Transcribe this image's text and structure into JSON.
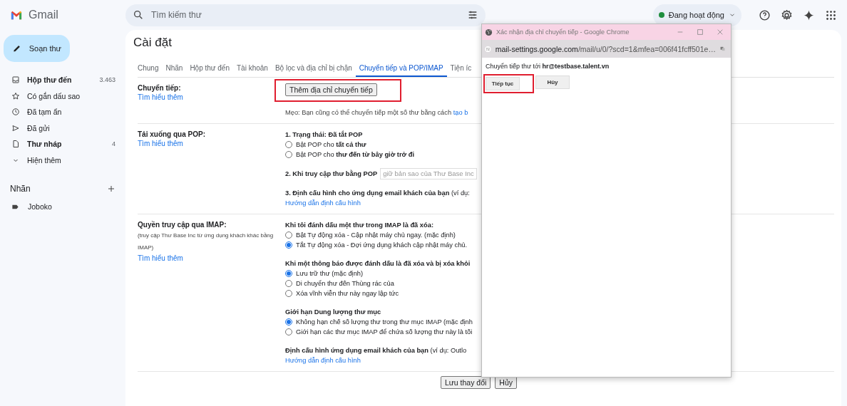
{
  "topbar": {
    "logo": "Gmail",
    "search": {
      "placeholder": "Tìm kiếm thư"
    },
    "status": {
      "label": "Đang hoạt động",
      "color": "#1e8e3e"
    }
  },
  "sidebar": {
    "compose": "Soạn thư",
    "items": [
      {
        "kind": "inbox",
        "label": "Hộp thư đến",
        "count": "3.463",
        "bold": true
      },
      {
        "kind": "star",
        "label": "Có gắn dấu sao",
        "bold": false
      },
      {
        "kind": "snooze",
        "label": "Đã tạm ẩn",
        "bold": false
      },
      {
        "kind": "sent",
        "label": "Đã gửi",
        "bold": false
      },
      {
        "kind": "draft",
        "label": "Thư nháp",
        "count": "4",
        "bold": true
      },
      {
        "kind": "more",
        "label": "Hiện thêm",
        "bold": false
      }
    ],
    "labels_heading": "Nhãn",
    "labels": [
      {
        "name": "Joboko"
      }
    ]
  },
  "settings": {
    "title": "Cài đặt",
    "tabs": [
      {
        "label": "Chung",
        "selected": false
      },
      {
        "label": "Nhãn",
        "selected": false
      },
      {
        "label": "Hộp thư đến",
        "selected": false
      },
      {
        "label": "Tài khoản",
        "selected": false
      },
      {
        "label": "Bộ lọc và địa chỉ bị chặn",
        "selected": false
      },
      {
        "label": "Chuyển tiếp và POP/IMAP",
        "selected": true
      },
      {
        "label": "Tiện íc",
        "selected": false
      }
    ],
    "sections": [
      {
        "label": "Chuyển tiếp:",
        "link": "Tìm hiểu thêm",
        "blocks": [
          {
            "kind": "button",
            "label": "Thêm địa chỉ chuyển tiếp",
            "highlighted": true
          },
          {
            "kind": "tip",
            "text": "Mẹo: Bạn cũng có thể chuyển tiếp một số thư bằng cách",
            "link": "tạo b"
          }
        ]
      },
      {
        "label": "Tải xuống qua POP:",
        "link": "Tìm hiểu thêm",
        "blocks": [
          {
            "kind": "radios",
            "heading": "1. Trạng thái: Đã tắt POP",
            "options": [
              {
                "label": "Bật POP cho **tất cả thư**",
                "selected": false
              },
              {
                "label": "Bật POP cho **thư đến từ bây giờ trở đi**",
                "selected": false
              }
            ]
          },
          {
            "kind": "select",
            "heading": "2. Khi truy cập thư bằng POP",
            "value": "giữ bản sao của Thư Base Inc"
          },
          {
            "kind": "config",
            "text": "**3. Định cấu hình cho ứng dụng email khách của bạn** (ví dụ:",
            "link": "Hướng dẫn định cấu hình"
          }
        ]
      },
      {
        "label": "Quyền truy cập qua IMAP:",
        "note": "(truy cập Thư Base Inc từ ứng dụng khách khác bằng IMAP)",
        "link": "Tìm hiểu thêm",
        "blocks": [
          {
            "kind": "radios",
            "heading": "Khi tôi đánh dấu một thư trong IMAP là đã xóa:",
            "options": [
              {
                "label": "Bật Tự động xóa - Cập nhật máy chủ ngay. (mặc định)",
                "selected": false
              },
              {
                "label": "Tắt Tự động xóa - Đợi ứng dụng khách cập nhật máy chủ.",
                "selected": true
              }
            ]
          },
          {
            "kind": "radios",
            "heading": "Khi một thông báo được đánh dấu là đã xóa và bị xóa khỏi",
            "options": [
              {
                "label": "Lưu trữ thư (mặc định)",
                "selected": true
              },
              {
                "label": "Di chuyển thư đến Thùng rác của",
                "selected": false
              },
              {
                "label": "Xóa vĩnh viễn thư này ngay lập tức",
                "selected": false
              }
            ]
          },
          {
            "kind": "radios",
            "heading": "Giới hạn Dung lượng thư mục",
            "options": [
              {
                "label": "Không hạn chế số lượng thư trong thư mục IMAP (mặc định",
                "selected": true
              },
              {
                "label": "Giới hạn các thư mục IMAP để chứa số lượng thư này là tối",
                "selected": false
              }
            ]
          },
          {
            "kind": "config",
            "text": "**Định cấu hình ứng dụng email khách của bạn** (ví dụ: Outlo",
            "link": "Hướng dẫn định cấu hình"
          }
        ]
      }
    ],
    "footer_buttons": [
      "Lưu thay đổi",
      "Hủy"
    ]
  },
  "popup": {
    "title": "Xác nhận địa chỉ chuyển tiếp - Google Chrome",
    "url_host": "mail-settings.google.com",
    "url_path": "/mail/u/0/?scd=1&mfea=006f41fcff501e…",
    "message": "Chuyển tiếp thư tới **hr@testbase.talent.vn**",
    "buttons": [
      {
        "label": "Tiếp tục",
        "highlighted": true
      },
      {
        "label": "Hủy",
        "highlighted": false
      }
    ]
  }
}
